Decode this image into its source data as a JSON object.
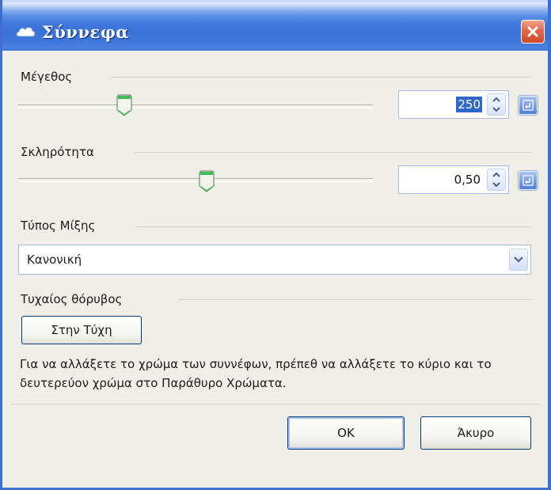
{
  "window": {
    "title": "Σύννεφα",
    "icon": "cloud-icon"
  },
  "size": {
    "label": "Μέγεθος",
    "value": "250",
    "slider_fraction": 0.25
  },
  "hardness": {
    "label": "Σκληρότητα",
    "value": "0,50",
    "slider_fraction": 0.5
  },
  "blend_mode": {
    "label": "Τύπος Μίξης",
    "selected": "Κανονική"
  },
  "random_noise": {
    "label": "Τυχαίος θόρυβος",
    "button_label": "Στην Τύχη"
  },
  "info": "Για να αλλάξετε το χρώμα των συννέφων, πρέπεθ να αλλάξετε το κύριο και το δευτερεύον χρώμα στο Παράθυρο Χρώματα.",
  "buttons": {
    "ok": "OK",
    "cancel": "Άκυρο"
  }
}
